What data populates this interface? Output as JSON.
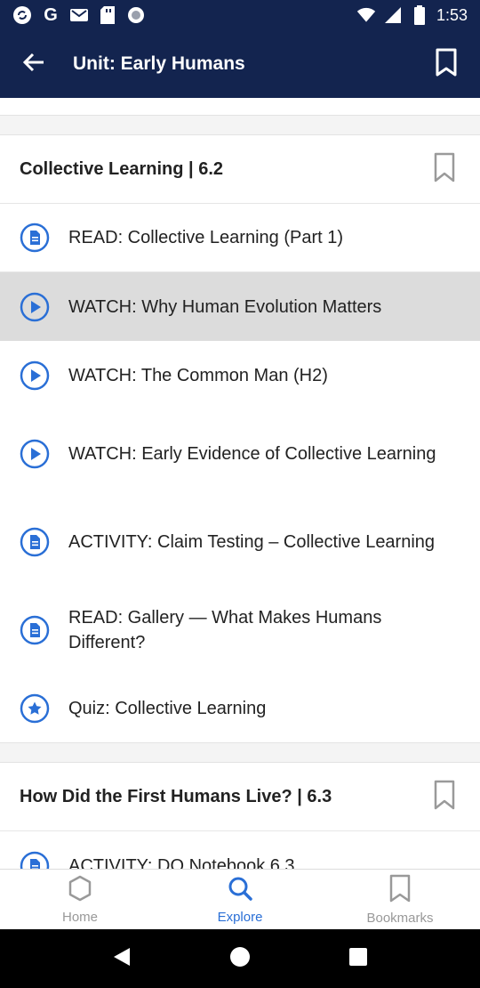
{
  "status_bar": {
    "time": "1:53",
    "icons": [
      "sync-icon",
      "google-icon",
      "gmail-icon",
      "sd-card-icon",
      "circle-app-icon",
      "wifi-icon",
      "signal-icon",
      "battery-icon"
    ]
  },
  "app_bar": {
    "title": "Unit: Early Humans",
    "back_icon": "arrow-left-icon",
    "bookmark_icon": "bookmark-icon"
  },
  "sections": [
    {
      "title": "Collective Learning | 6.2",
      "items": [
        {
          "type": "read",
          "icon": "document-icon",
          "label": "READ: Collective Learning (Part 1)"
        },
        {
          "type": "watch",
          "icon": "play-icon",
          "label": "WATCH: Why Human Evolution Matters",
          "selected": true
        },
        {
          "type": "watch",
          "icon": "play-icon",
          "label": "WATCH: The Common Man (H2)"
        },
        {
          "type": "watch",
          "icon": "play-icon",
          "label": "WATCH: Early Evidence of Collective Learning"
        },
        {
          "type": "activity",
          "icon": "document-icon",
          "label": "ACTIVITY: Claim Testing – Collective Learning"
        },
        {
          "type": "read",
          "icon": "document-icon",
          "label": "READ: Gallery — What Makes Humans Different?"
        },
        {
          "type": "quiz",
          "icon": "star-icon",
          "label": "Quiz: Collective Learning"
        }
      ]
    },
    {
      "title": "How Did the First Humans Live? | 6.3",
      "items": [
        {
          "type": "activity",
          "icon": "document-icon",
          "label": "ACTIVITY: DQ Notebook 6.3"
        }
      ]
    }
  ],
  "bottom_nav": {
    "items": [
      {
        "label": "Home",
        "icon": "hexagon-icon",
        "active": false
      },
      {
        "label": "Explore",
        "icon": "search-icon",
        "active": true
      },
      {
        "label": "Bookmarks",
        "icon": "bookmark-icon",
        "active": false
      }
    ]
  },
  "colors": {
    "primary": "#13244f",
    "accent": "#2a6fd6",
    "selected_row": "#dcdcdc",
    "inactive_nav": "#999999"
  }
}
